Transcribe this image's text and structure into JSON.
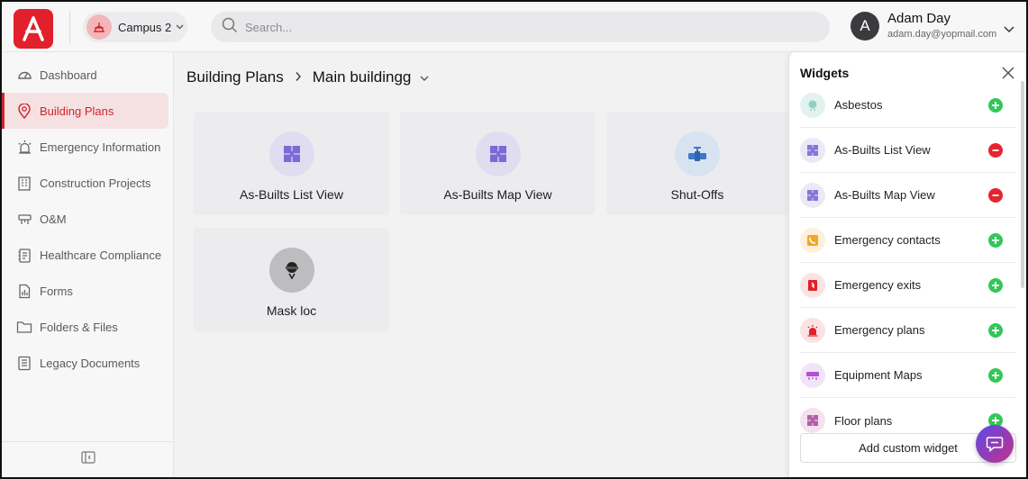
{
  "header": {
    "campus_label": "Campus 2",
    "search_placeholder": "Search...",
    "user_initial": "A",
    "user_name": "Adam Day",
    "user_email": "adam.day@yopmail.com"
  },
  "sidebar": {
    "items": [
      {
        "label": "Dashboard",
        "icon": "gauge-icon",
        "active": false
      },
      {
        "label": "Building Plans",
        "icon": "location-pin-icon",
        "active": true
      },
      {
        "label": "Emergency Information",
        "icon": "siren-icon",
        "active": false
      },
      {
        "label": "Construction Projects",
        "icon": "building-icon",
        "active": false
      },
      {
        "label": "O&M",
        "icon": "wrench-icon",
        "active": false
      },
      {
        "label": "Healthcare Compliance",
        "icon": "clipboard-icon",
        "active": false
      },
      {
        "label": "Forms",
        "icon": "form-icon",
        "active": false
      },
      {
        "label": "Folders & Files",
        "icon": "folder-icon",
        "active": false
      },
      {
        "label": "Legacy Documents",
        "icon": "documents-icon",
        "active": false
      }
    ]
  },
  "breadcrumb": {
    "root": "Building Plans",
    "current": "Main buildingg"
  },
  "cards": [
    {
      "title": "As-Builts List View",
      "icon": "floorplan-icon"
    },
    {
      "title": "As-Builts Map View",
      "icon": "floorplan-icon"
    },
    {
      "title": "Shut-Offs",
      "icon": "valve-icon"
    },
    {
      "title": "Mask loc",
      "icon": "mask-icon"
    }
  ],
  "widgets": {
    "title": "Widgets",
    "items": [
      {
        "label": "Asbestos",
        "action": "add",
        "icon": "asbestos-icon"
      },
      {
        "label": "As-Builts List View",
        "action": "remove",
        "icon": "floorplan-icon"
      },
      {
        "label": "As-Builts Map View",
        "action": "remove",
        "icon": "floorplan-icon"
      },
      {
        "label": "Emergency contacts",
        "action": "add",
        "icon": "phone-icon"
      },
      {
        "label": "Emergency exits",
        "action": "add",
        "icon": "exit-icon"
      },
      {
        "label": "Emergency plans",
        "action": "add",
        "icon": "alarm-icon"
      },
      {
        "label": "Equipment Maps",
        "action": "add",
        "icon": "equipment-icon"
      },
      {
        "label": "Floor plans",
        "action": "add",
        "icon": "floorplan-icon"
      }
    ],
    "add_custom_label": "Add custom widget"
  },
  "colors": {
    "brand": "#e2202b",
    "active": "#d1242f",
    "add": "#34c759",
    "remove": "#e5252f",
    "tile_purple": "#e4e1f1",
    "icon_purple": "#7a6bd6"
  }
}
